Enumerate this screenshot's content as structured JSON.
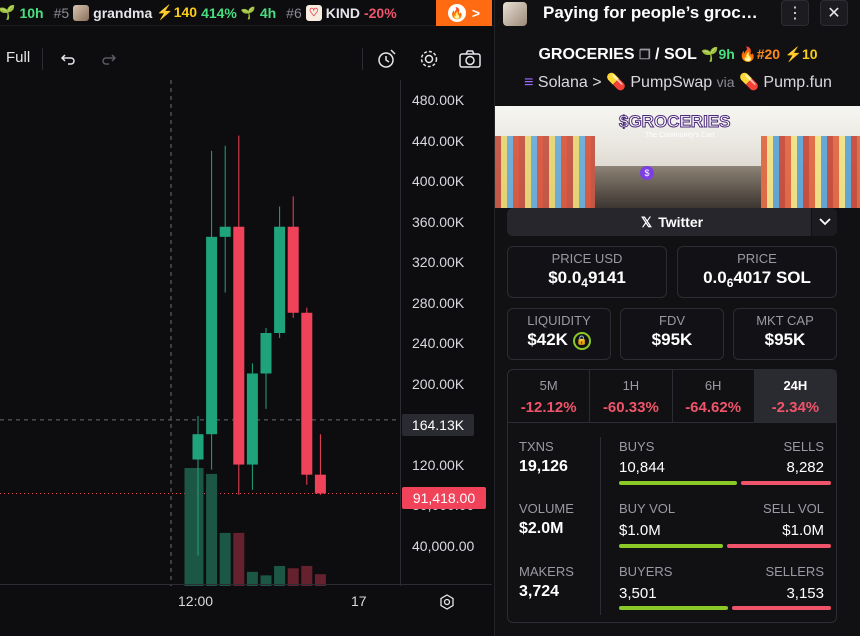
{
  "ticker": {
    "items": [
      {
        "rank": "",
        "name": "",
        "age": "10h",
        "avatar": "leaf-icon"
      },
      {
        "rank": "#5",
        "name": "grandma",
        "boost": "⚡140",
        "change": "414%",
        "age": "4h"
      },
      {
        "rank": "#6",
        "name": "KIND",
        "change": "-20%"
      }
    ],
    "fire_arrow": ">"
  },
  "toolbar": {
    "full_label": "Full"
  },
  "chart_data": {
    "type": "candlestick",
    "y_ticks": [
      "480.00K",
      "440.00K",
      "400.00K",
      "360.00K",
      "320.00K",
      "280.00K",
      "240.00K",
      "200.00K",
      "120.00K",
      "80,000.00",
      "40,000.00"
    ],
    "x_ticks": [
      "12:00",
      "17"
    ],
    "crosshair_label": "164.13K",
    "last_price_label": "91,418.00",
    "ylim": [
      0,
      500000
    ],
    "candles": [
      {
        "o": 125000,
        "h": 168000,
        "l": 30000,
        "c": 150000,
        "dir": "up"
      },
      {
        "o": 150000,
        "h": 430000,
        "l": 115000,
        "c": 345000,
        "dir": "up"
      },
      {
        "o": 345000,
        "h": 435000,
        "l": 290000,
        "c": 355000,
        "dir": "up"
      },
      {
        "o": 355000,
        "h": 445000,
        "l": 90000,
        "c": 120000,
        "dir": "down"
      },
      {
        "o": 120000,
        "h": 220000,
        "l": 95000,
        "c": 210000,
        "dir": "up"
      },
      {
        "o": 210000,
        "h": 255000,
        "l": 175000,
        "c": 250000,
        "dir": "up"
      },
      {
        "o": 250000,
        "h": 375000,
        "l": 245000,
        "c": 355000,
        "dir": "up"
      },
      {
        "o": 355000,
        "h": 385000,
        "l": 265000,
        "c": 270000,
        "dir": "down"
      },
      {
        "o": 270000,
        "h": 275000,
        "l": 100000,
        "c": 110000,
        "dir": "down"
      },
      {
        "o": 110000,
        "h": 150000,
        "l": 90000,
        "c": 91418,
        "dir": "down"
      }
    ],
    "volumes": [
      {
        "v": 100,
        "dir": "up"
      },
      {
        "v": 95,
        "dir": "up"
      },
      {
        "v": 45,
        "dir": "up"
      },
      {
        "v": 45,
        "dir": "down"
      },
      {
        "v": 12,
        "dir": "up"
      },
      {
        "v": 9,
        "dir": "up"
      },
      {
        "v": 17,
        "dir": "up"
      },
      {
        "v": 15,
        "dir": "down"
      },
      {
        "v": 17,
        "dir": "down"
      },
      {
        "v": 10,
        "dir": "down"
      }
    ],
    "colors": {
      "up": "#1fa37a",
      "down": "#f0435a"
    }
  },
  "panel": {
    "title": "Paying for people’s groc…",
    "pair_base": "GROCERIES",
    "pair_sep": "/",
    "pair_quote": "SOL",
    "age": "9h",
    "rank": "#20",
    "boost": "10",
    "chain": "Solana",
    "dex": "PumpSwap",
    "via": "via",
    "launchpad": "Pump.fun",
    "banner_title": "$GROCERIES",
    "banner_sub": "The Community's Cart",
    "twitter_label": "Twitter",
    "price_usd_label": "PRICE USD",
    "price_usd_a": "$0.0",
    "price_usd_sub": "4",
    "price_usd_b": "9141",
    "price_label": "PRICE",
    "price_sol_a": "0.0",
    "price_sol_sub": "6",
    "price_sol_b": "4017 SOL",
    "liquidity_label": "LIQUIDITY",
    "liquidity_value": "$42K",
    "fdv_label": "FDV",
    "fdv_value": "$95K",
    "mcap_label": "MKT CAP",
    "mcap_value": "$95K",
    "tabs": [
      {
        "label": "5M",
        "value": "-12.12%"
      },
      {
        "label": "1H",
        "value": "-60.33%"
      },
      {
        "label": "6H",
        "value": "-64.62%"
      },
      {
        "label": "24H",
        "value": "-2.34%"
      }
    ],
    "txns_label": "TXNS",
    "txns_value": "19,126",
    "buys_label": "BUYS",
    "buys_value": "10,844",
    "sells_label": "SELLS",
    "sells_value": "8,282",
    "buy_ratio": 0.567,
    "volume_label": "VOLUME",
    "volume_value": "$2.0M",
    "buy_vol_label": "BUY VOL",
    "buy_vol_value": "$1.0M",
    "sell_vol_label": "SELL VOL",
    "sell_vol_value": "$1.0M",
    "vol_ratio": 0.5,
    "makers_label": "MAKERS",
    "makers_value": "3,724",
    "buyers_label": "BUYERS",
    "buyers_value": "3,501",
    "sellers_label": "SELLERS",
    "sellers_value": "3,153",
    "buyer_ratio": 0.526
  }
}
